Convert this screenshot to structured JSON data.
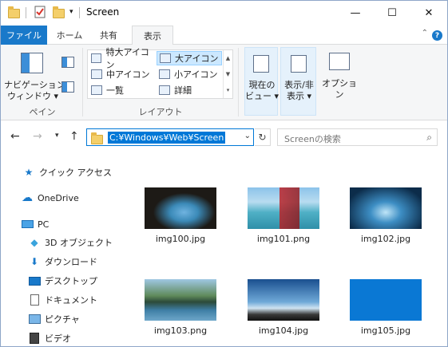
{
  "window": {
    "title": "Screen",
    "controls": {
      "minimize": "—",
      "maximize": "☐",
      "close": "✕"
    }
  },
  "ribbon_tabs": [
    "ファイル",
    "ホーム",
    "共有",
    "表示"
  ],
  "ribbon": {
    "pane_group": {
      "nav_pane_label": "ナビゲーション\nウィンドウ ▾",
      "group_label": "ペイン"
    },
    "layout_group": {
      "items": [
        "特大アイコン",
        "大アイコン",
        "中アイコン",
        "小アイコン",
        "一覧",
        "詳細"
      ],
      "selected": "大アイコン",
      "group_label": "レイアウト"
    },
    "current_view_label": "現在の\nビュー ▾",
    "show_hide_label": "表示/非\n表示 ▾",
    "options_label": "オプション"
  },
  "address_bar": {
    "path": "C:¥Windows¥Web¥Screen",
    "search_placeholder": "Screenの検索"
  },
  "nav_pane": {
    "quick_access": "クイック アクセス",
    "onedrive": "OneDrive",
    "pc": "PC",
    "pc_items": [
      "3D オブジェクト",
      "ダウンロード",
      "デスクトップ",
      "ドキュメント",
      "ピクチャ",
      "ビデオ"
    ]
  },
  "files": [
    {
      "name": "img100.jpg",
      "icon": "cave-beach-thumbnail"
    },
    {
      "name": "img101.png",
      "icon": "sea-sail-thumbnail"
    },
    {
      "name": "img102.jpg",
      "icon": "ice-cave-thumbnail"
    },
    {
      "name": "img103.png",
      "icon": "mountain-lake-thumbnail"
    },
    {
      "name": "img104.jpg",
      "icon": "hill-sky-thumbnail"
    },
    {
      "name": "img105.jpg",
      "icon": "solid-blue-thumbnail"
    }
  ],
  "colors": {
    "accent": "#1979ca",
    "selection": "#cce8ff",
    "blue_fill": "#0a78d4"
  }
}
